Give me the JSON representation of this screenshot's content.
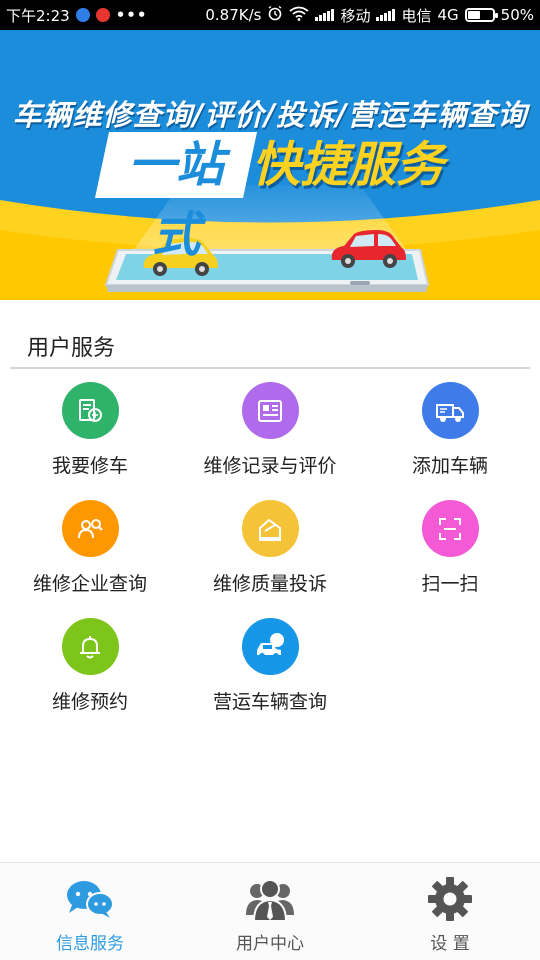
{
  "status_bar": {
    "time": "下午2:23",
    "more": "•••",
    "speed": "0.87K/s",
    "carrier1": "移动",
    "carrier2": "电信",
    "network": "4G",
    "battery": "50%",
    "battery_level": 0.5,
    "icons": [
      "app-notification-icon",
      "video-notification-icon",
      "alarm-icon",
      "wifi-icon",
      "signal-icon",
      "battery-icon"
    ]
  },
  "banner": {
    "line1": "车辆维修查询/评价/投诉/营运车辆查询",
    "highlight_left": "一站式",
    "highlight_right": "快捷服务",
    "colors": {
      "sky": "#1c8ddb",
      "ground": "#ffd21f"
    }
  },
  "section": {
    "title": "用户服务"
  },
  "services": [
    {
      "label": "我要修车",
      "icon": "repair-car-icon",
      "color": "#2fb36b"
    },
    {
      "label": "维修记录与评价",
      "icon": "record-document-icon",
      "color": "#b06bed"
    },
    {
      "label": "添加车辆",
      "icon": "add-truck-icon",
      "color": "#3f7be9"
    },
    {
      "label": "维修企业查询",
      "icon": "enterprise-search-icon",
      "color": "#ff9800"
    },
    {
      "label": "维修质量投诉",
      "icon": "complaint-icon",
      "color": "#f5c338"
    },
    {
      "label": "扫一扫",
      "icon": "scan-icon",
      "color": "#f45ad6"
    },
    {
      "label": "维修预约",
      "icon": "bell-icon",
      "color": "#7dc51a"
    },
    {
      "label": "营运车辆查询",
      "icon": "operating-vehicle-icon",
      "color": "#1596e6"
    }
  ],
  "bottom_nav": [
    {
      "label": "信息服务",
      "icon": "chat-bubbles-icon",
      "active": true,
      "color": "#2e9be0"
    },
    {
      "label": "用户中心",
      "icon": "user-icon",
      "active": false,
      "color": "#555555"
    },
    {
      "label": "设 置",
      "icon": "gear-icon",
      "active": false,
      "color": "#555555"
    }
  ]
}
